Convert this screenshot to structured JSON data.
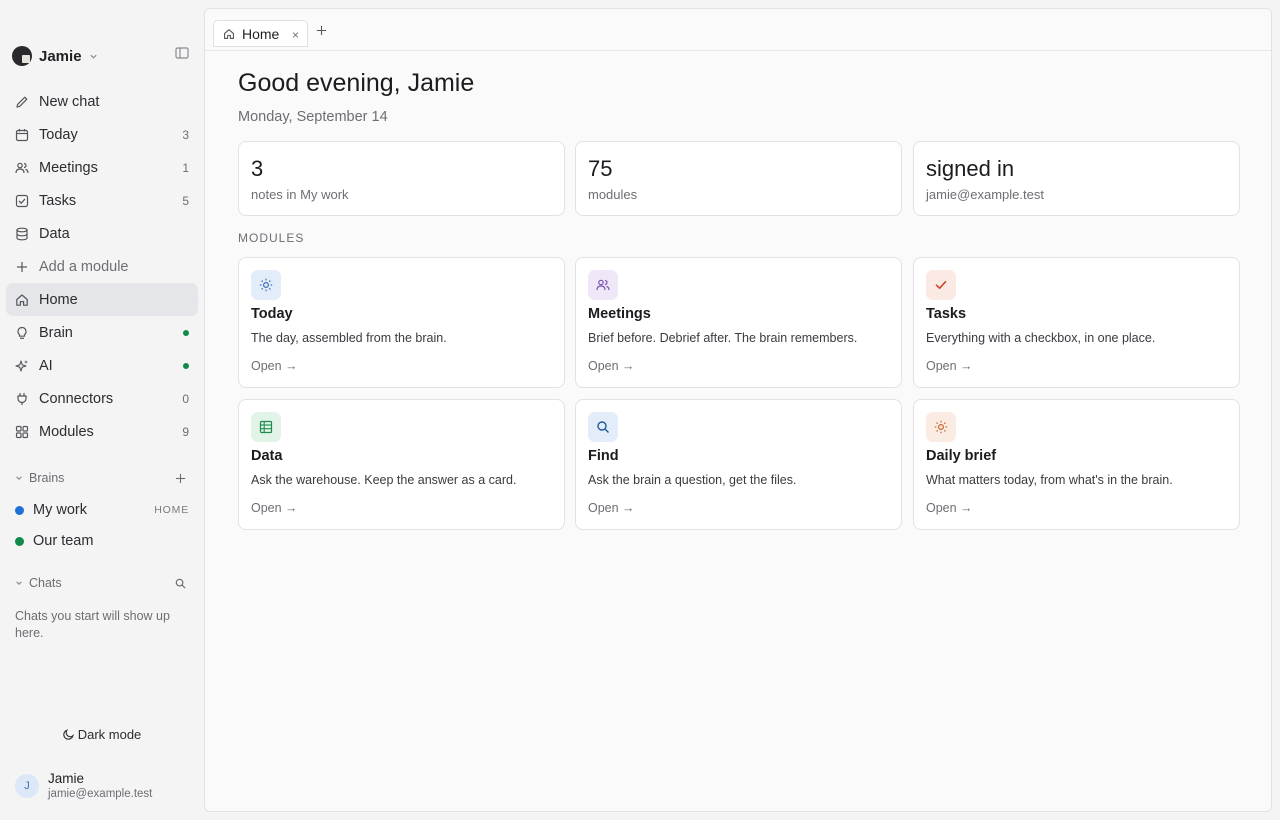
{
  "workspace": {
    "name": "Jamie"
  },
  "nav": {
    "items": [
      {
        "label": "New chat",
        "icon": "pencil-icon",
        "count": ""
      },
      {
        "label": "Today",
        "icon": "calendar-icon",
        "count": "3"
      },
      {
        "label": "Meetings",
        "icon": "users-icon",
        "count": "1"
      },
      {
        "label": "Tasks",
        "icon": "checkbox-icon",
        "count": "5"
      },
      {
        "label": "Data",
        "icon": "database-icon",
        "count": ""
      },
      {
        "label": "Add a module",
        "icon": "plus-icon",
        "count": ""
      },
      {
        "label": "Home",
        "icon": "home-icon",
        "count": ""
      },
      {
        "label": "Brain",
        "icon": "lightbulb-icon",
        "count": ""
      },
      {
        "label": "AI",
        "icon": "sparkle-icon",
        "count": ""
      },
      {
        "label": "Connectors",
        "icon": "plug-icon",
        "count": "0"
      },
      {
        "label": "Modules",
        "icon": "grid-icon",
        "count": "9"
      }
    ]
  },
  "brains": {
    "title": "Brains",
    "items": [
      {
        "label": "My work",
        "tag": "HOME",
        "color": "#1f6fd6"
      },
      {
        "label": "Our team",
        "tag": "",
        "color": "#0f8a4a"
      }
    ]
  },
  "chats": {
    "title": "Chats",
    "empty_text": "Chats you start will show up here."
  },
  "dark_mode_label": "Dark mode",
  "user": {
    "initial": "J",
    "name": "Jamie",
    "email": "jamie@example.test"
  },
  "tabs": [
    {
      "label": "Home",
      "close": "×"
    }
  ],
  "new_tab": "+",
  "main": {
    "greeting": "Good evening, Jamie",
    "date": "Monday, September 14",
    "stats": [
      {
        "value": "3",
        "label": "notes in My work"
      },
      {
        "value": "75",
        "label": "modules"
      },
      {
        "value": "signed in",
        "label": "jamie@example.test"
      }
    ],
    "modules_heading": "MODULES",
    "modules": [
      {
        "title": "Today",
        "desc": "The day, assembled from the brain.",
        "open": "Open →",
        "icon": "sun-icon",
        "bg": "#e3edf9",
        "fg": "#3a6fb5"
      },
      {
        "title": "Meetings",
        "desc": "Brief before. Debrief after. The brain remembers.",
        "open": "Open →",
        "icon": "users-icon",
        "bg": "#efe7f7",
        "fg": "#7a55b0"
      },
      {
        "title": "Tasks",
        "desc": "Everything with a checkbox, in one place.",
        "open": "Open →",
        "icon": "check-icon",
        "bg": "#fbe9e3",
        "fg": "#c8472a"
      },
      {
        "title": "Data",
        "desc": "Ask the warehouse. Keep the answer as a card.",
        "open": "Open →",
        "icon": "table-icon",
        "bg": "#e2f3e8",
        "fg": "#1f8a4c"
      },
      {
        "title": "Find",
        "desc": "Ask the brain a question, get the files.",
        "open": "Open →",
        "icon": "search-icon",
        "bg": "#e3edf9",
        "fg": "#245a9c"
      },
      {
        "title": "Daily brief",
        "desc": "What matters today, from what's in the brain.",
        "open": "Open →",
        "icon": "sun-icon",
        "bg": "#fbece3",
        "fg": "#c8642a"
      }
    ]
  }
}
